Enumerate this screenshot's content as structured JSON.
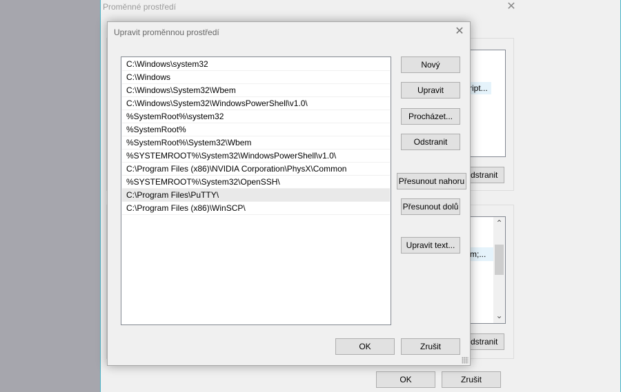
{
  "outer_dialog": {
    "title": "Proměnné prostředí",
    "close_glyph": "✕",
    "user_list_snippet": "ript...",
    "user_delete_label": "Odstranit",
    "user_delete_partial": "dstranit",
    "system_list_snippet": "m;...",
    "system_delete_partial": "dstranit",
    "ok_label": "OK",
    "cancel_label": "Zrušit",
    "scroll_up_glyph": "⌃",
    "scroll_down_glyph": "⌄"
  },
  "edit_dialog": {
    "title": "Upravit proměnnou prostředí",
    "close_glyph": "✕",
    "paths": [
      "C:\\Windows\\system32",
      "C:\\Windows",
      "C:\\Windows\\System32\\Wbem",
      "C:\\Windows\\System32\\WindowsPowerShell\\v1.0\\",
      "%SystemRoot%\\system32",
      "%SystemRoot%",
      "%SystemRoot%\\System32\\Wbem",
      "%SYSTEMROOT%\\System32\\WindowsPowerShell\\v1.0\\",
      "C:\\Program Files (x86)\\NVIDIA Corporation\\PhysX\\Common",
      "%SYSTEMROOT%\\System32\\OpenSSH\\",
      "C:\\Program Files\\PuTTY\\",
      "C:\\Program Files (x86)\\WinSCP\\"
    ],
    "selected_index": 10,
    "buttons": {
      "new": "Nový",
      "edit": "Upravit",
      "browse": "Procházet...",
      "delete": "Odstranit",
      "move_up": "Přesunout nahoru",
      "move_down": "Přesunout dolů",
      "edit_text": "Upravit text..."
    },
    "ok_label": "OK",
    "cancel_label": "Zrušit"
  }
}
